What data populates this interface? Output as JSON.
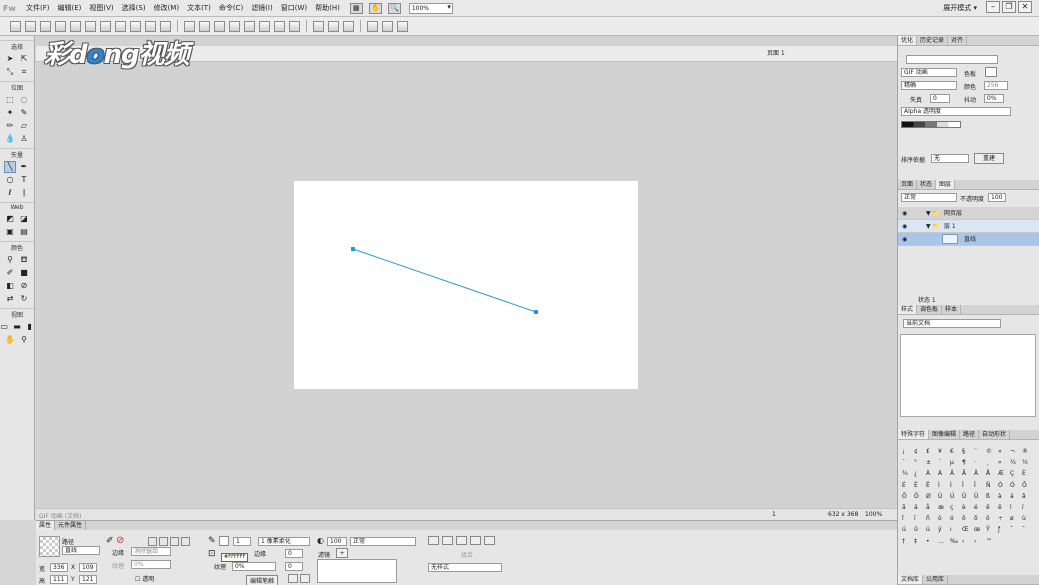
{
  "menu": {
    "logo": "Fw",
    "items": [
      "文件(F)",
      "编辑(E)",
      "视图(V)",
      "选择(S)",
      "修改(M)",
      "文本(T)",
      "命令(C)",
      "滤镜(I)",
      "窗口(W)",
      "帮助(H)"
    ],
    "zoom": "100%",
    "workspace": "展开模式 ▾"
  },
  "tools": {
    "sections": [
      "选择",
      "位图",
      "矢量",
      "Web",
      "颜色",
      "视图"
    ]
  },
  "document": {
    "page": "页面 1",
    "status_left": "GIF 动画 (文档)",
    "frame": "1",
    "size": "632 x 368",
    "zoom": "100%",
    "accent_color": "#2a9ad6"
  },
  "watermark": {
    "part1": "彩d",
    "part2": "o",
    "part3": "ng视频"
  },
  "properties": {
    "tabs": [
      "属性",
      "元件属性"
    ],
    "object_type": "路径",
    "object_name": "直线",
    "stroke_label": "边缘",
    "stroke_edge": "消除锯齿",
    "fill_label": "纹理",
    "fill_texture": "0%",
    "stroke_size": "1",
    "stroke_kind": "1 像素柔化",
    "texture_label": "纹理",
    "texture_value": "0%",
    "edge_label": "边缘",
    "edge_value": "0",
    "opacity": "100",
    "blend": "正常",
    "transparent_label": "透明",
    "filters_label": "滤镜",
    "style": "无样式",
    "w_label": "宽",
    "w": "336",
    "x_label": "X",
    "x": "109",
    "h_label": "高",
    "h": "111",
    "y_label": "Y",
    "y": "121",
    "edit_stroke": "编辑笔触",
    "combine": "组合",
    "tooltip": "#FFFFFF"
  },
  "right_panel": {
    "optimize_tabs": [
      "优化",
      "历史记录",
      "对齐"
    ],
    "format": "GIF 动画",
    "palette_label": "色板",
    "dither_mode": "精确",
    "colors_label": "颜色",
    "colors_value": "256",
    "loss_label": "失真",
    "loss_value": "0",
    "dither_label": "抖动",
    "dither_value": "0%",
    "alpha": "Alpha 透明度",
    "sort_label": "排序依据",
    "sort_value": "无",
    "rebuild": "重建",
    "layer_tabs": [
      "页面",
      "状态",
      "图层"
    ],
    "blend": "正常",
    "opacity_label": "不透明度",
    "opacity_value": "100",
    "layers": [
      {
        "name": "网页层",
        "depth": 0
      },
      {
        "name": "层 1",
        "depth": 0
      },
      {
        "name": "直线",
        "depth": 1
      }
    ],
    "state": "状态 1",
    "styles_tabs": [
      "样式",
      "调色板",
      "样本"
    ],
    "styles_doc": "当前文档",
    "char_tabs": [
      "特殊字符",
      "图像编辑",
      "路径",
      "自动形状"
    ],
    "bottom_tabs": [
      "文档库",
      "公用库"
    ],
    "chars": [
      "¡",
      "¢",
      "£",
      "¥",
      "€",
      "§",
      "¨",
      "©",
      "«",
      "¬",
      "®",
      "¯",
      "°",
      "±",
      "´",
      "µ",
      "¶",
      "·",
      "¸",
      "»",
      "¼",
      "½",
      "¾",
      "¿",
      "À",
      "Á",
      "Â",
      "Ã",
      "Ä",
      "Å",
      "Æ",
      "Ç",
      "È",
      "É",
      "Ê",
      "Ë",
      "Ì",
      "Í",
      "Î",
      "Ï",
      "Ñ",
      "Ò",
      "Ó",
      "Ô",
      "Õ",
      "Ö",
      "Ø",
      "Ù",
      "Ú",
      "Û",
      "Ü",
      "ß",
      "à",
      "á",
      "â",
      "ã",
      "ä",
      "å",
      "æ",
      "ç",
      "è",
      "é",
      "ê",
      "ë",
      "ì",
      "í",
      "î",
      "ï",
      "ñ",
      "ò",
      "ó",
      "ô",
      "õ",
      "ö",
      "÷",
      "ø",
      "ù",
      "ú",
      "û",
      "ü",
      "ÿ",
      "ı",
      "Œ",
      "œ",
      "Ÿ",
      "ƒ",
      "ˆ",
      "˜",
      "†",
      "‡",
      "•",
      "…",
      "‰",
      "‹",
      "›",
      "™"
    ]
  }
}
